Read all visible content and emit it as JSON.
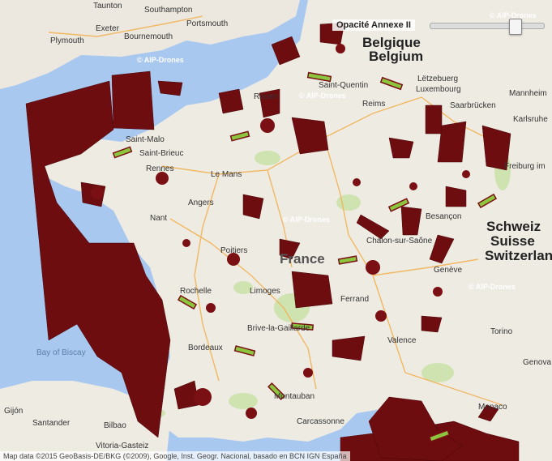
{
  "controls": {
    "opacity_label": "Opacité Annexe II",
    "opacity_value": 0.78
  },
  "watermark": "© AIP-Drones",
  "places": {
    "taunton": "Taunton",
    "southampton": "Southampton",
    "exeter": "Exeter",
    "portsmouth": "Portsmouth",
    "plymouth": "Plymouth",
    "bournemouth": "Bournemouth",
    "belgique": "Belgique",
    "belgium": "Belgium",
    "saint_quentin": "Saint-Quentin",
    "letzebuerg": "Lëtzebuerg",
    "luxembourg": "Luxembourg",
    "saarbrucken": "Saarbrücken",
    "mannheim": "Mannheim",
    "karlsruhe": "Karlsruhe",
    "saint_malo": "Saint-Malo",
    "saint_brieuc": "Saint-Brieuc",
    "rennes": "Rennes",
    "le_mans": "Le Mans",
    "reims": "Reims",
    "rouen": "Rouen",
    "freiburg": "Freiburg im",
    "angers": "Angers",
    "nantes": "Nant",
    "besancon": "Besançon",
    "schweiz": "Schweiz",
    "suisse": "Suisse",
    "switzerland": "Switzerlan",
    "chalon": "Chalon-sur-Saône",
    "rochelle": "Rochelle",
    "poitiers": "Poitiers",
    "france": "France",
    "geneve": "Genève",
    "limoges": "Limoges",
    "ferrand": "Ferrand",
    "brive": "Brive-la-Gaillarde",
    "bordeaux": "Bordeaux",
    "valence": "Valence",
    "torino": "Torino",
    "bay_of_biscay": "Bay of Biscay",
    "montauban": "Montauban",
    "gijon": "Gijón",
    "santander": "Santander",
    "bilbao": "Bilbao",
    "vitoria": "Vitoria-Gasteiz",
    "carcassonne": "Carcassonne",
    "monaco": "Monaco",
    "genova": "Genova"
  },
  "attribution": "Map data ©2015 GeoBasis-DE/BKG (©2009), Google, Inst. Geogr. Nacional, basado en BCN IGN España"
}
